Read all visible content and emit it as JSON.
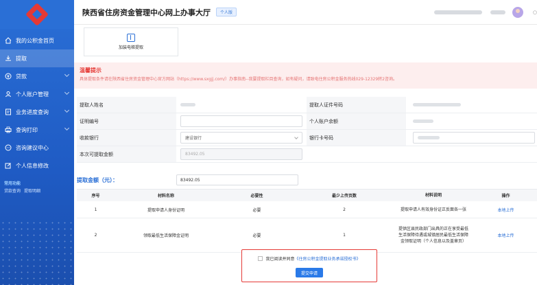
{
  "header": {
    "title": "陕西省住房资金管理中心网上办事大厅",
    "badge": "个人版"
  },
  "sidebar": {
    "items": [
      {
        "label": "我的公积金首页",
        "icon": "home-icon"
      },
      {
        "label": "提取",
        "icon": "withdraw-icon"
      },
      {
        "label": "贷款",
        "icon": "loan-icon"
      },
      {
        "label": "个人账户管理",
        "icon": "user-account-icon"
      },
      {
        "label": "业务进度查询",
        "icon": "progress-icon"
      },
      {
        "label": "查询打印",
        "icon": "print-icon"
      },
      {
        "label": "咨询建议中心",
        "icon": "chat-icon"
      },
      {
        "label": "个人信息修改",
        "icon": "edit-icon"
      }
    ],
    "common_title": "常用功能",
    "common_links": [
      "贷款查询",
      "提取明细"
    ]
  },
  "card_button": {
    "label": "加装电梯提取"
  },
  "notice": {
    "title": "温馨提示",
    "body": "具体提取条件请在陕西省住房资金管理中心官方网站（https://www.sxgjj.com/）办事指南--我要提取栏目查询，如有疑问，请致电住房公积金服务热线029-12329转2咨询。"
  },
  "form": {
    "name_label": "提取人姓名",
    "id_label": "提取人证件号码",
    "proof_label": "证明编号",
    "balance_label": "个人账户余额",
    "bank_label": "收款银行",
    "bank_value": "建设银行",
    "card_label": "银行卡号码",
    "max_label": "本次可提取金额",
    "max_value": "83492.05"
  },
  "amount": {
    "label": "提取金额（元）：",
    "value": "83492.05"
  },
  "table": {
    "headers": [
      "序号",
      "材料名称",
      "必要性",
      "最少上传页数",
      "材料说明",
      "操作"
    ],
    "rows": [
      {
        "no": "1",
        "name": "提取申请人身份证明",
        "req": "必要",
        "pages": "2",
        "desc": "提取申请人有效身份证正反面各一张",
        "op": "本地上传"
      },
      {
        "no": "2",
        "name": "领取最低生活保障金证明",
        "req": "必要",
        "pages": "1",
        "desc": "提供区县民政部门出具的正在享受最低生活保障待遇或城镇居民最低生活保障金领取证明（个人信息以及盖章页）",
        "op": "本地上传"
      }
    ]
  },
  "footer": {
    "agree_text": "我已阅读并同意",
    "agree_link": "《住房公积金提取业务承诺授权书》",
    "submit": "提交申请"
  }
}
